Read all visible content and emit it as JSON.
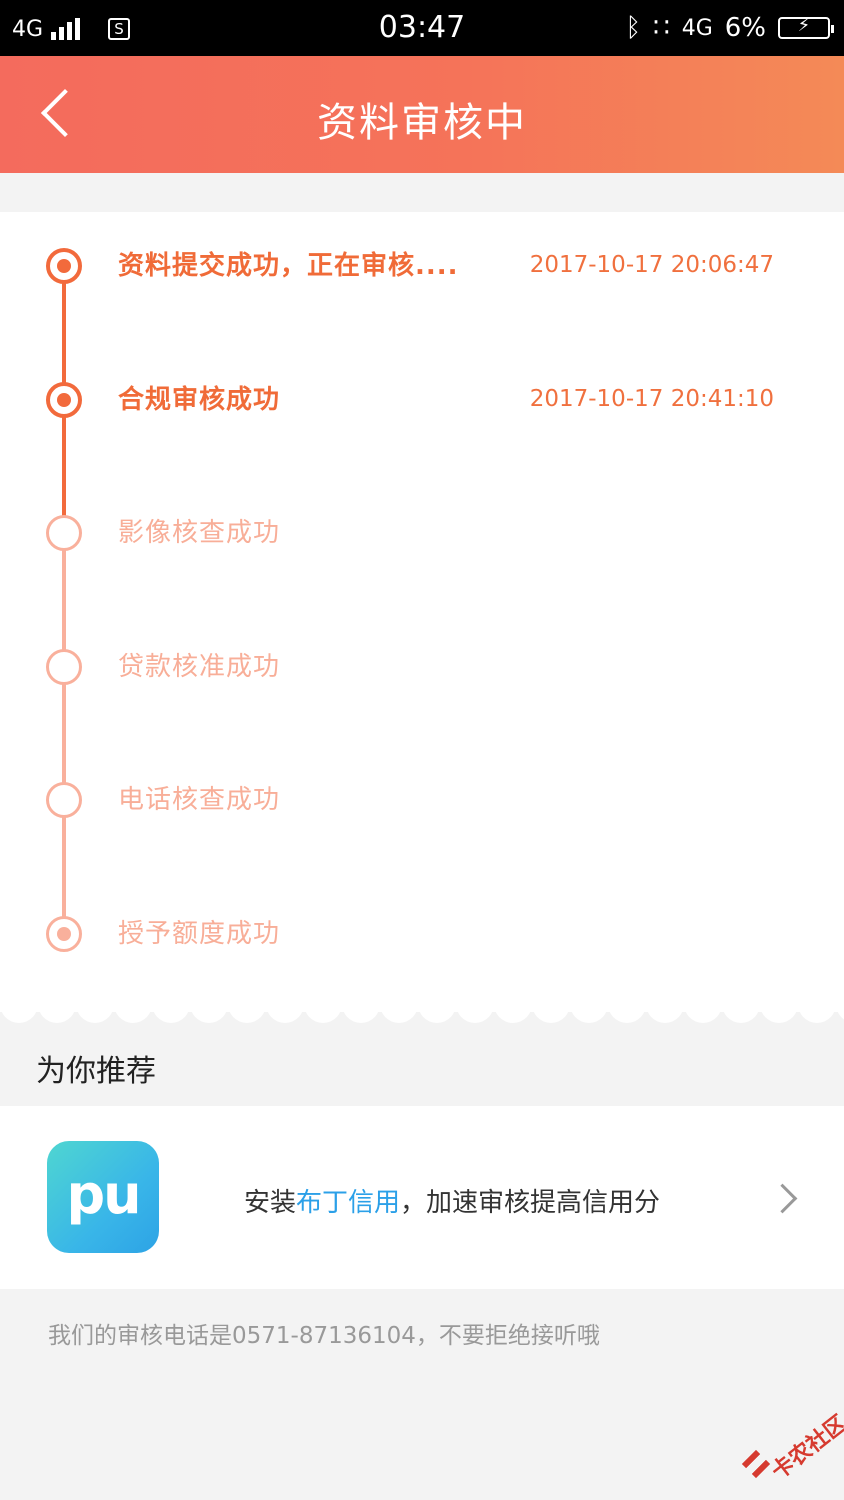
{
  "status_bar": {
    "network": "4G",
    "time": "03:47",
    "network_right": "4G",
    "battery": "6%",
    "icons": [
      "signal-icon",
      "sim-icon",
      "bluetooth-icon",
      "vibrate-icon",
      "battery-charging-icon"
    ]
  },
  "header": {
    "title": "资料审核中",
    "back_icon": "chevron-left-icon"
  },
  "timeline": {
    "steps": [
      {
        "label": "资料提交成功，正在审核....",
        "time": "2017-10-17 20:06:47",
        "status": "done"
      },
      {
        "label": "合规审核成功",
        "time": "2017-10-17 20:41:10",
        "status": "done"
      },
      {
        "label": "影像核查成功",
        "status": "pending"
      },
      {
        "label": "贷款核准成功",
        "status": "pending"
      },
      {
        "label": "电话核查成功",
        "status": "pending"
      },
      {
        "label": "授予额度成功",
        "status": "pending"
      }
    ],
    "colors": {
      "done": "#f06b38",
      "pending": "#f8ae98"
    }
  },
  "recommend": {
    "title": "为你推荐",
    "logo_text": "pu",
    "text_before": "安装",
    "app_name": "布丁信用",
    "text_after": "，加速审核提高信用分"
  },
  "footer": {
    "note": "我们的审核电话是0571-87136104，不要拒绝接听哦"
  },
  "watermark": {
    "text": "卡农社区"
  }
}
